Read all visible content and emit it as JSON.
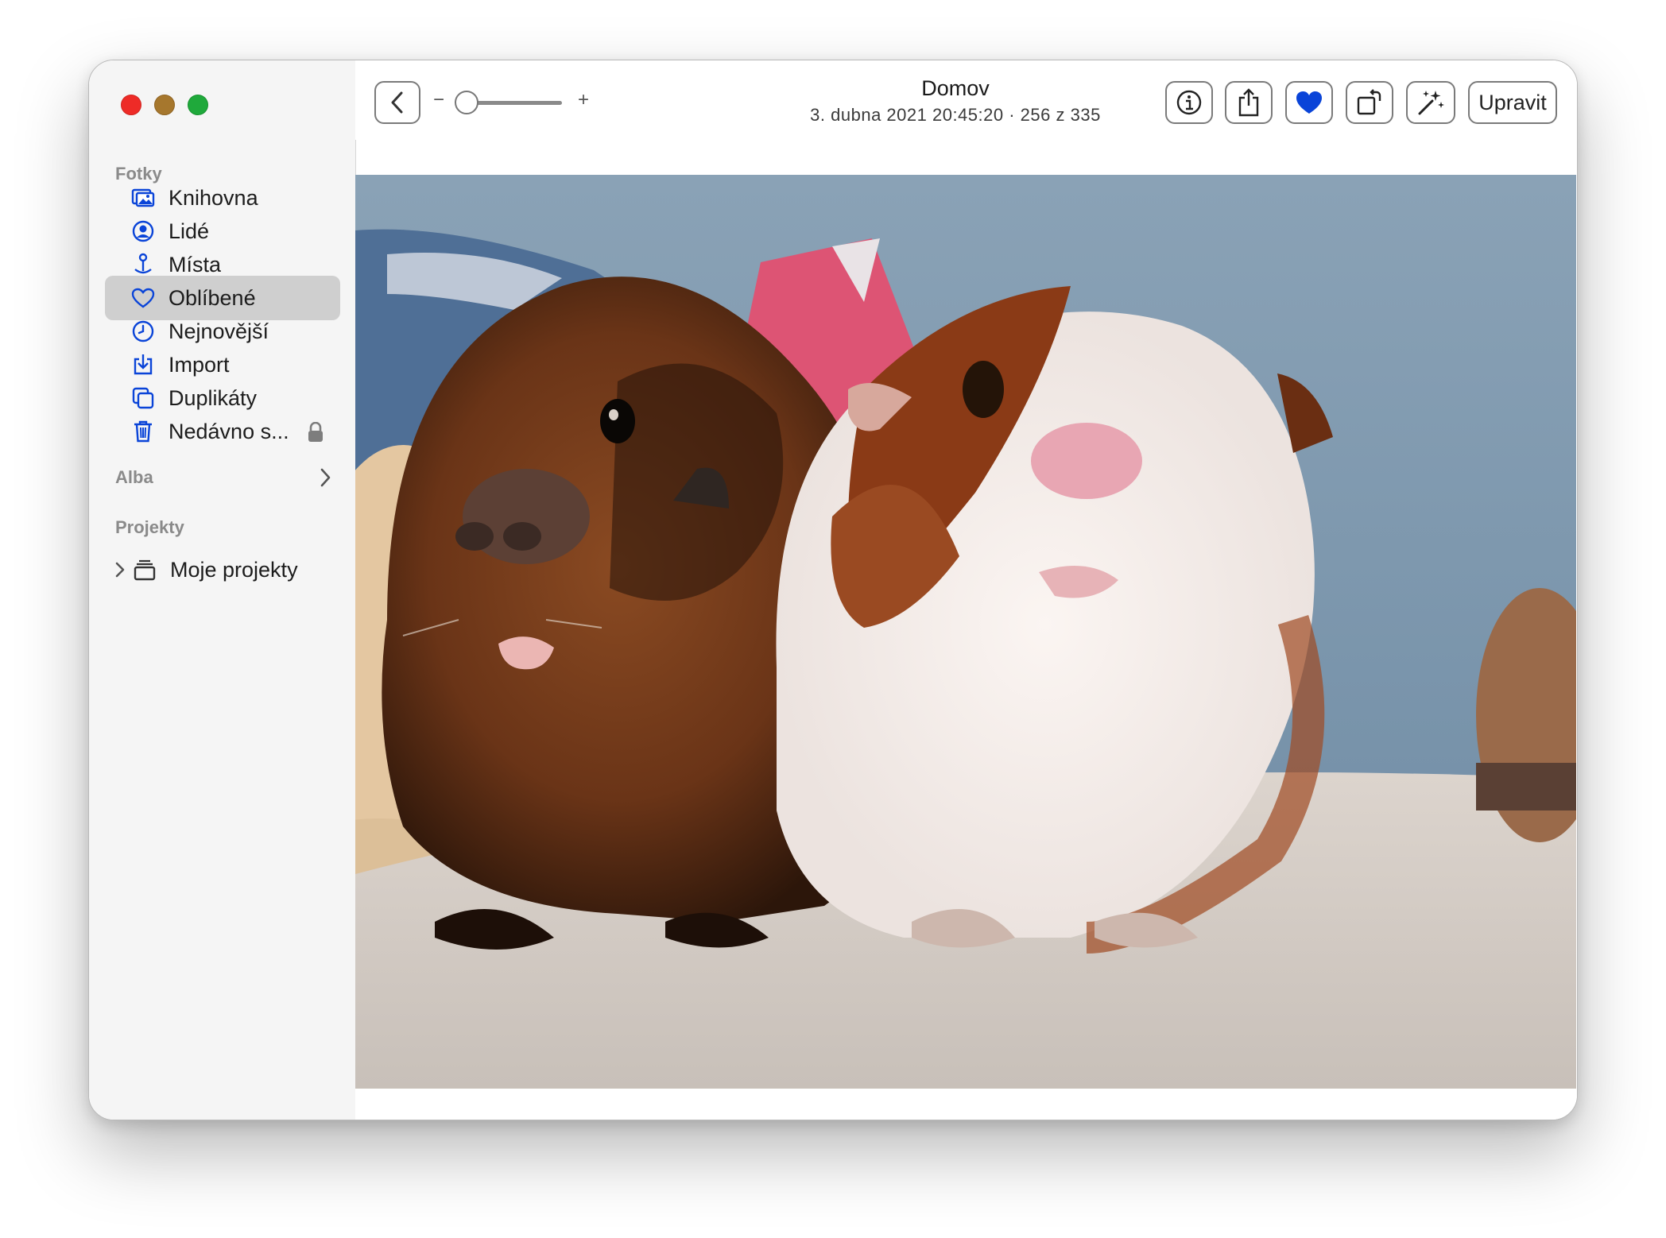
{
  "sidebar": {
    "sections": {
      "fotky": "Fotky",
      "alba": "Alba",
      "projekty": "Projekty"
    },
    "items": [
      {
        "label": "Knihovna",
        "icon": "photo-library-icon"
      },
      {
        "label": "Lidé",
        "icon": "person-circle-icon"
      },
      {
        "label": "Místa",
        "icon": "map-pin-icon"
      },
      {
        "label": "Oblíbené",
        "icon": "heart-icon",
        "selected": true
      },
      {
        "label": "Nejnovější",
        "icon": "clock-icon"
      },
      {
        "label": "Import",
        "icon": "import-icon"
      },
      {
        "label": "Duplikáty",
        "icon": "duplicates-icon"
      },
      {
        "label": "Nedávno s...",
        "icon": "trash-icon",
        "locked": true
      }
    ],
    "projects": [
      {
        "label": "Moje projekty",
        "icon": "projects-icon"
      }
    ]
  },
  "toolbar": {
    "title": "Domov",
    "subtitle": "3. dubna 2021 20:45:20  ·  256 z 335",
    "zoom_minus": "−",
    "zoom_plus": "+",
    "zoom_level": 0.0,
    "edit_label": "Upravit",
    "favorite_color": "#0a44d8",
    "icons": [
      "back-icon",
      "info-icon",
      "share-icon",
      "heart-filled-icon",
      "rotate-icon",
      "magic-wand-icon"
    ]
  },
  "colors": {
    "accent": "#0a44d8",
    "sidebar_bg": "#f5f5f5",
    "selected_bg": "#cfcfcf"
  }
}
